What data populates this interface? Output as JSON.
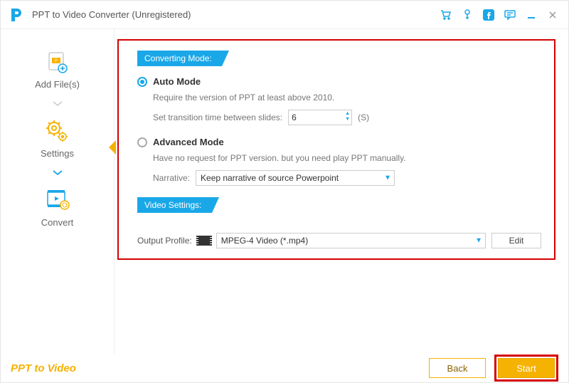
{
  "title": "PPT to Video Converter (Unregistered)",
  "sidebar": {
    "items": [
      {
        "label": "Add File(s)"
      },
      {
        "label": "Settings"
      },
      {
        "label": "Convert"
      }
    ]
  },
  "sections": {
    "converting_label": "Converting Mode:",
    "video_label": "Video Settings:"
  },
  "auto": {
    "title": "Auto Mode",
    "desc": "Require the version of PPT at least above 2010.",
    "transition_label": "Set transition time between slides:",
    "transition_value": "6",
    "transition_unit": "(S)"
  },
  "advanced": {
    "title": "Advanced Mode",
    "desc": "Have no request for PPT version. but you need play PPT manually.",
    "narrative_label": "Narrative:",
    "narrative_value": "Keep narrative of source Powerpoint"
  },
  "output": {
    "label": "Output Profile:",
    "value": "MPEG-4 Video (*.mp4)",
    "edit": "Edit"
  },
  "footer": {
    "brand": "PPT to Video",
    "back": "Back",
    "start": "Start"
  }
}
